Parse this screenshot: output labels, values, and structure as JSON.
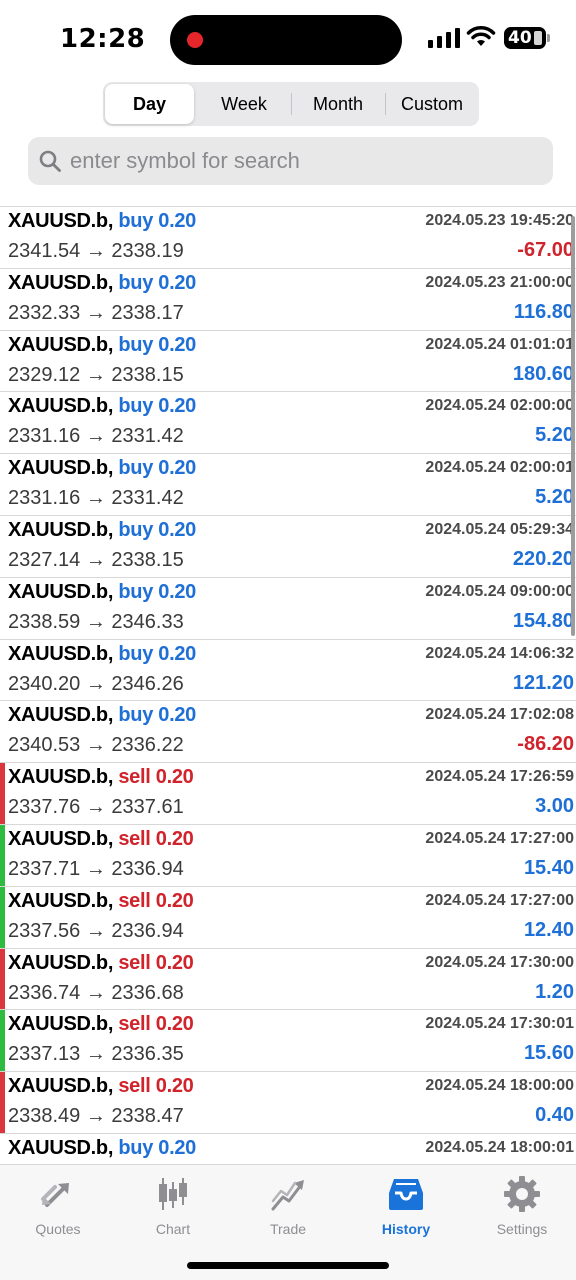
{
  "status": {
    "time": "12:28",
    "battery": "40"
  },
  "tabs_period": [
    {
      "label": "Day",
      "active": true
    },
    {
      "label": "Week",
      "active": false
    },
    {
      "label": "Month",
      "active": false
    },
    {
      "label": "Custom",
      "active": false
    }
  ],
  "search": {
    "placeholder": "enter symbol for search",
    "icon": "magnifier-icon"
  },
  "colors": {
    "buy": "#1e6fd6",
    "sell": "#d0232b",
    "profit_positive": "#1e6fd6",
    "profit_negative": "#d0232b",
    "marker_red": "#d9363e",
    "marker_green": "#2fbb3f",
    "active_tab": "#1a73d9"
  },
  "deals": [
    {
      "symbol": "XAUUSD.b,",
      "side": "buy 0.20",
      "type": "buy",
      "prices": "2341.54 → 2338.19",
      "time": "2024.05.23 19:45:20",
      "profit": "-67.00",
      "marker": ""
    },
    {
      "symbol": "XAUUSD.b,",
      "side": "buy 0.20",
      "type": "buy",
      "prices": "2332.33 → 2338.17",
      "time": "2024.05.23 21:00:00",
      "profit": "116.80",
      "marker": ""
    },
    {
      "symbol": "XAUUSD.b,",
      "side": "buy 0.20",
      "type": "buy",
      "prices": "2329.12 → 2338.15",
      "time": "2024.05.24 01:01:01",
      "profit": "180.60",
      "marker": ""
    },
    {
      "symbol": "XAUUSD.b,",
      "side": "buy 0.20",
      "type": "buy",
      "prices": "2331.16 → 2331.42",
      "time": "2024.05.24 02:00:00",
      "profit": "5.20",
      "marker": ""
    },
    {
      "symbol": "XAUUSD.b,",
      "side": "buy 0.20",
      "type": "buy",
      "prices": "2331.16 → 2331.42",
      "time": "2024.05.24 02:00:01",
      "profit": "5.20",
      "marker": ""
    },
    {
      "symbol": "XAUUSD.b,",
      "side": "buy 0.20",
      "type": "buy",
      "prices": "2327.14 → 2338.15",
      "time": "2024.05.24 05:29:34",
      "profit": "220.20",
      "marker": ""
    },
    {
      "symbol": "XAUUSD.b,",
      "side": "buy 0.20",
      "type": "buy",
      "prices": "2338.59 → 2346.33",
      "time": "2024.05.24 09:00:00",
      "profit": "154.80",
      "marker": ""
    },
    {
      "symbol": "XAUUSD.b,",
      "side": "buy 0.20",
      "type": "buy",
      "prices": "2340.20 → 2346.26",
      "time": "2024.05.24 14:06:32",
      "profit": "121.20",
      "marker": ""
    },
    {
      "symbol": "XAUUSD.b,",
      "side": "buy 0.20",
      "type": "buy",
      "prices": "2340.53 → 2336.22",
      "time": "2024.05.24 17:02:08",
      "profit": "-86.20",
      "marker": ""
    },
    {
      "symbol": "XAUUSD.b,",
      "side": "sell 0.20",
      "type": "sell",
      "prices": "2337.76 → 2337.61",
      "time": "2024.05.24 17:26:59",
      "profit": "3.00",
      "marker": "red"
    },
    {
      "symbol": "XAUUSD.b,",
      "side": "sell 0.20",
      "type": "sell",
      "prices": "2337.71 → 2336.94",
      "time": "2024.05.24 17:27:00",
      "profit": "15.40",
      "marker": "green"
    },
    {
      "symbol": "XAUUSD.b,",
      "side": "sell 0.20",
      "type": "sell",
      "prices": "2337.56 → 2336.94",
      "time": "2024.05.24 17:27:00",
      "profit": "12.40",
      "marker": "green"
    },
    {
      "symbol": "XAUUSD.b,",
      "side": "sell 0.20",
      "type": "sell",
      "prices": "2336.74 → 2336.68",
      "time": "2024.05.24 17:30:00",
      "profit": "1.20",
      "marker": "red"
    },
    {
      "symbol": "XAUUSD.b,",
      "side": "sell 0.20",
      "type": "sell",
      "prices": "2337.13 → 2336.35",
      "time": "2024.05.24 17:30:01",
      "profit": "15.60",
      "marker": "green"
    },
    {
      "symbol": "XAUUSD.b,",
      "side": "sell 0.20",
      "type": "sell",
      "prices": "2338.49 → 2338.47",
      "time": "2024.05.24 18:00:00",
      "profit": "0.40",
      "marker": "red"
    },
    {
      "symbol": "XAUUSD.b,",
      "side": "buy 0.20",
      "type": "buy",
      "prices": "",
      "time": "2024.05.24 18:00:01",
      "profit": "",
      "marker": ""
    }
  ],
  "tabbar": [
    {
      "label": "Quotes",
      "icon": "quotes-arrows-icon",
      "active": false
    },
    {
      "label": "Chart",
      "icon": "candlestick-chart-icon",
      "active": false
    },
    {
      "label": "Trade",
      "icon": "trade-trend-icon",
      "active": false
    },
    {
      "label": "History",
      "icon": "history-inbox-icon",
      "active": true
    },
    {
      "label": "Settings",
      "icon": "gear-icon",
      "active": false
    }
  ]
}
